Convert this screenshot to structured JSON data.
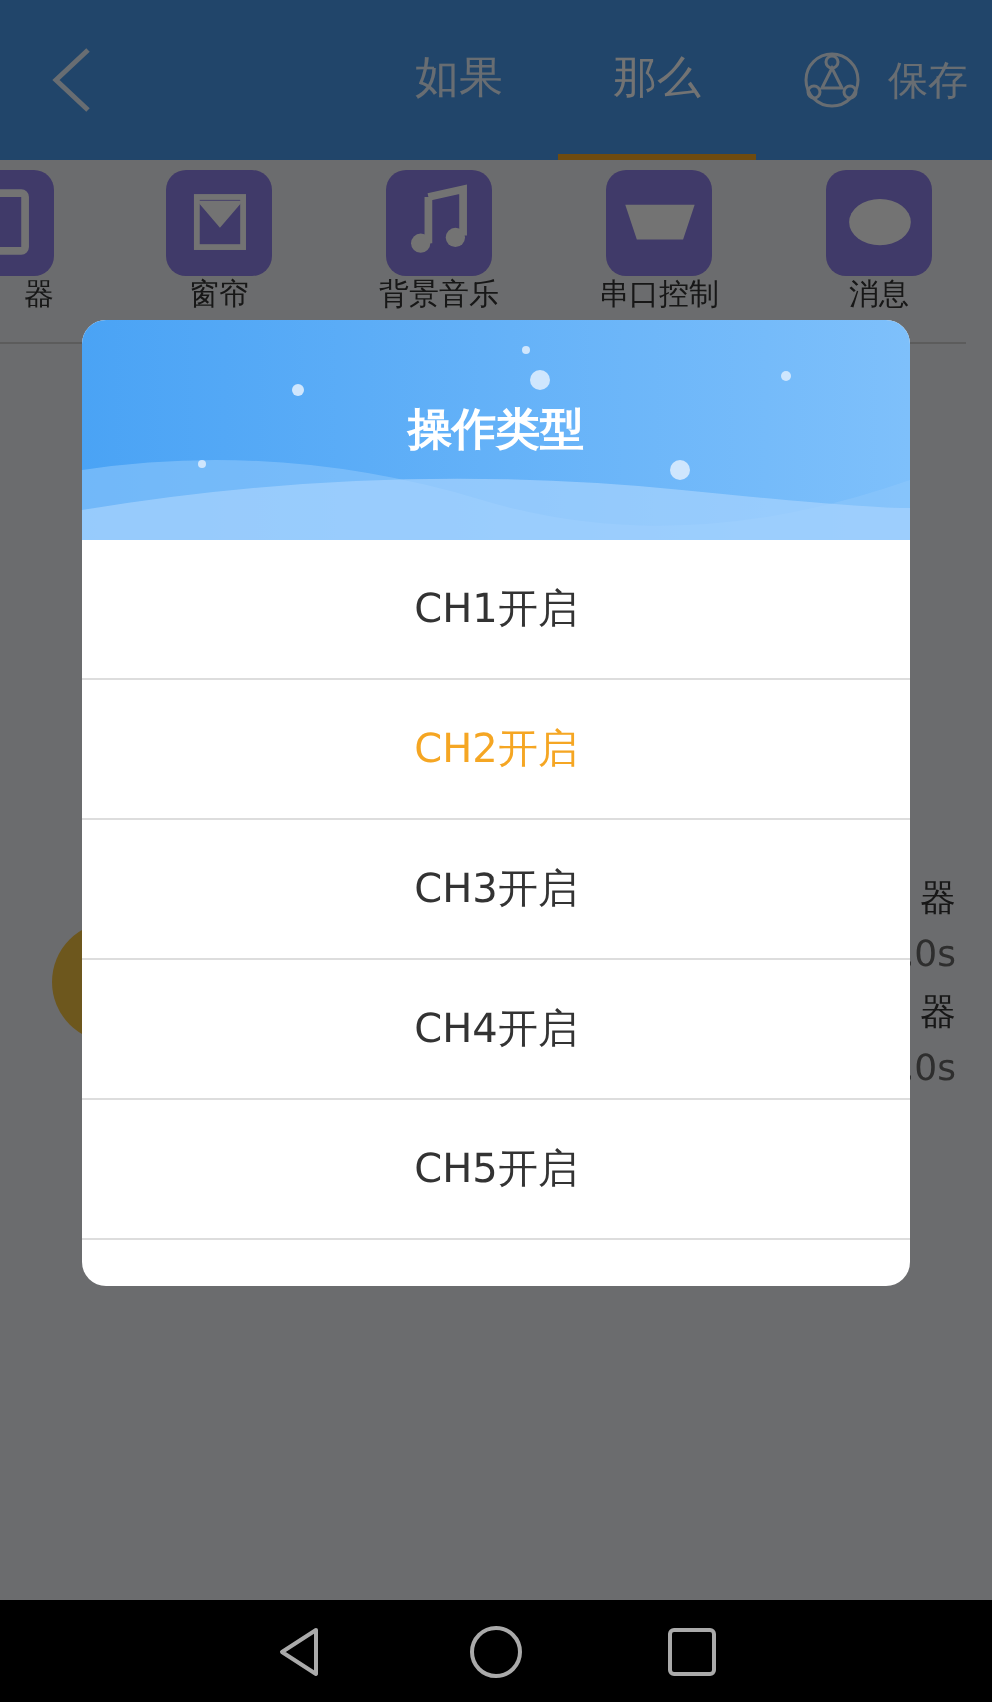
{
  "header": {
    "tabs": [
      {
        "label": "如果",
        "selected": false
      },
      {
        "label": "那么",
        "selected": true
      }
    ],
    "save": "保存"
  },
  "categories": [
    {
      "label": "器",
      "kind": "remote"
    },
    {
      "label": "窗帘",
      "kind": "curtain"
    },
    {
      "label": "背景音乐",
      "kind": "music"
    },
    {
      "label": "串口控制",
      "kind": "serial"
    },
    {
      "label": "消息",
      "kind": "message"
    }
  ],
  "actions": [
    {
      "name": "器",
      "detail": ",0s"
    },
    {
      "name": "器",
      "detail": ",0s"
    }
  ],
  "dialog": {
    "title": "操作类型",
    "options": [
      {
        "label": "CH1开启",
        "selected": false
      },
      {
        "label": "CH2开启",
        "selected": true
      },
      {
        "label": "CH3开启",
        "selected": false
      },
      {
        "label": "CH4开启",
        "selected": false
      },
      {
        "label": "CH5开启",
        "selected": false
      }
    ]
  }
}
